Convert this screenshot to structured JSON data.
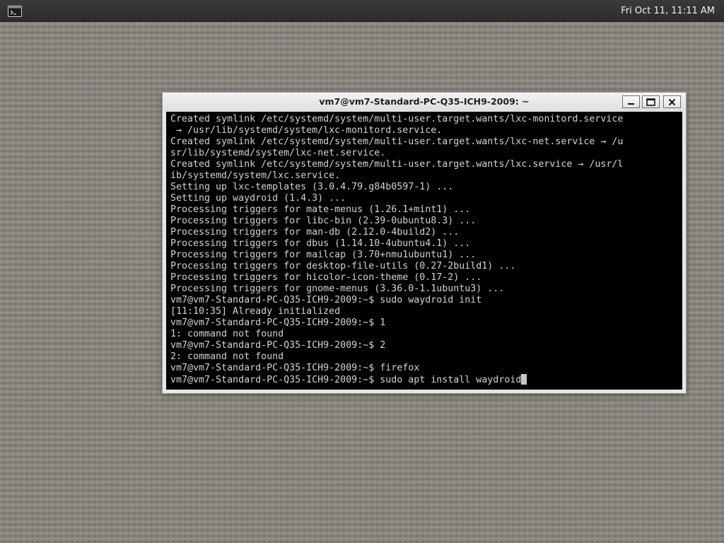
{
  "panel": {
    "clock": "Fri Oct 11, 11:11 AM",
    "launcher_icon": "terminal-icon"
  },
  "window": {
    "title": "vm7@vm7-Standard-PC-Q35-ICH9-2009: ~",
    "buttons": {
      "minimize_icon": "minimize-icon",
      "maximize_icon": "maximize-icon",
      "close_icon": "close-icon"
    }
  },
  "terminal": {
    "foreground": "#d3d3d3",
    "background": "#000000",
    "lines": [
      "Created symlink /etc/systemd/system/multi-user.target.wants/lxc-monitord.service",
      " → /usr/lib/systemd/system/lxc-monitord.service.",
      "Created symlink /etc/systemd/system/multi-user.target.wants/lxc-net.service → /u",
      "sr/lib/systemd/system/lxc-net.service.",
      "Created symlink /etc/systemd/system/multi-user.target.wants/lxc.service → /usr/l",
      "ib/systemd/system/lxc.service.",
      "Setting up lxc-templates (3.0.4.79.g84b0597-1) ...",
      "Setting up waydroid (1.4.3) ...",
      "Processing triggers for mate-menus (1.26.1+mint1) ...",
      "Processing triggers for libc-bin (2.39-0ubuntu8.3) ...",
      "Processing triggers for man-db (2.12.0-4build2) ...",
      "Processing triggers for dbus (1.14.10-4ubuntu4.1) ...",
      "Processing triggers for mailcap (3.70+nmu1ubuntu1) ...",
      "Processing triggers for desktop-file-utils (0.27-2build1) ...",
      "Processing triggers for hicolor-icon-theme (0.17-2) ...",
      "Processing triggers for gnome-menus (3.36.0-1.1ubuntu3) ...",
      "vm7@vm7-Standard-PC-Q35-ICH9-2009:~$ sudo waydroid init",
      "[11:10:35] Already initialized",
      "vm7@vm7-Standard-PC-Q35-ICH9-2009:~$ 1",
      "1: command not found",
      "vm7@vm7-Standard-PC-Q35-ICH9-2009:~$ 2",
      "2: command not found",
      "vm7@vm7-Standard-PC-Q35-ICH9-2009:~$ firefox"
    ],
    "prompt_line": "vm7@vm7-Standard-PC-Q35-ICH9-2009:~$ sudo apt install waydroid"
  }
}
